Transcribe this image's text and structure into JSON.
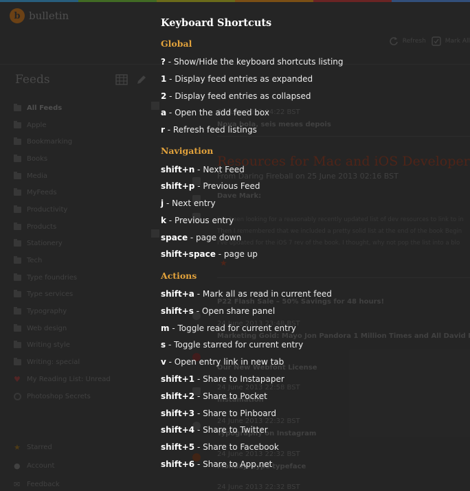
{
  "app": {
    "name": "bulletin",
    "logo_letter": "b"
  },
  "colors": {
    "stripe": [
      "#2e6b8f",
      "#4a7a2a",
      "#7a7a1e",
      "#8c5a18",
      "#7a2a2a",
      "#3a5a8c"
    ],
    "accent": "#e3a33c",
    "background": "#2b2b2b"
  },
  "toolbar": {
    "refresh_label": "Refresh",
    "mark_all_label": "Mark All"
  },
  "sidebar": {
    "title": "Feeds",
    "feeds": [
      "All Feeds",
      "Apple",
      "Bookmarking",
      "Books",
      "Media",
      "MyFeeds",
      "Productivity",
      "Products",
      "Stationery",
      "Tech",
      "Type foundries",
      "Type services",
      "Typography",
      "Web design",
      "Writing style",
      "Writing: special",
      "My Reading List: Unread",
      "Photoshop Secrets"
    ],
    "bottom": [
      "Starred",
      "Account",
      "Feedback"
    ]
  },
  "content": {
    "entries": [
      {
        "date": "25 June 2013 04:22 BST",
        "headline": "Nova bola, seis meses depois"
      },
      {
        "title": "Resources for Mac and iOS Developers",
        "byline": "From Daring Fireball on 25 June 2013 02:16 BST",
        "author": "Dave Mark:"
      },
      {
        "body1": "I've been looking for a reasonably recently updated list of dev resources to link to in",
        "body2": "Then I remembered that we included a pretty solid list at the end of the book Begin",
        "body3": "I've updated for the iOS 7 rev of the book. I thought, why not pop the list into a blo"
      },
      {
        "headline": "P22 Flash Sale – 50% Savings for 48 hours!"
      },
      {
        "date": "24 June 2013 23:48 BST",
        "headline": "Marketing Gold: Mayo Jon Pandora 1 Million Times and All David Lowery Got"
      },
      {
        "headline": "Our New Webfont License"
      },
      {
        "date": "24 June 2013 22:58 BST",
        "headline": "Instamation"
      },
      {
        "date": "24 June 2013 22:32 BST",
        "headline": "Typography on Instagram"
      },
      {
        "date": "24 June 2013 22:32 BST",
        "headline": "Monday: type typeface"
      },
      {
        "date": "24 June 2013 22:32 BST"
      }
    ]
  },
  "shortcuts": {
    "title": "Keyboard Shortcuts",
    "global_title": "Global",
    "global": [
      {
        "key": "?",
        "desc": " - Show/Hide the keyboard shortcuts listing"
      },
      {
        "key": "1",
        "desc": " - Display feed entries as expanded"
      },
      {
        "key": "2",
        "desc": " - Display feed entries as collapsed"
      },
      {
        "key": "a",
        "desc": " - Open the add feed box"
      },
      {
        "key": "r",
        "desc": " - Refresh feed listings"
      }
    ],
    "navigation_title": "Navigation",
    "navigation": [
      {
        "key": "shift+n",
        "desc": " - Next Feed"
      },
      {
        "key": "shift+p",
        "desc": " - Previous Feed"
      },
      {
        "key": "j",
        "desc": " - Next entry"
      },
      {
        "key": "k",
        "desc": " - Previous entry"
      },
      {
        "key": "space",
        "desc": " - page down"
      },
      {
        "key": "shift+space",
        "desc": " - page up"
      }
    ],
    "actions_title": "Actions",
    "actions": [
      {
        "key": "shift+a",
        "desc": " - Mark all as read in current feed"
      },
      {
        "key": "shift+s",
        "desc": " - Open share panel"
      },
      {
        "key": "m",
        "desc": " - Toggle read for current entry"
      },
      {
        "key": "s",
        "desc": " - Toggle starred for current entry"
      },
      {
        "key": "v",
        "desc": " - Open entry link in new tab"
      },
      {
        "key": "shift+1",
        "desc": " - Share to Instapaper"
      },
      {
        "key": "shift+2",
        "desc": " - Share to Pocket"
      },
      {
        "key": "shift+3",
        "desc": " - Share to Pinboard"
      },
      {
        "key": "shift+4",
        "desc": " - Share to Twitter"
      },
      {
        "key": "shift+5",
        "desc": " - Share to Facebook"
      },
      {
        "key": "shift+6",
        "desc": " - Share to App.net"
      }
    ]
  }
}
